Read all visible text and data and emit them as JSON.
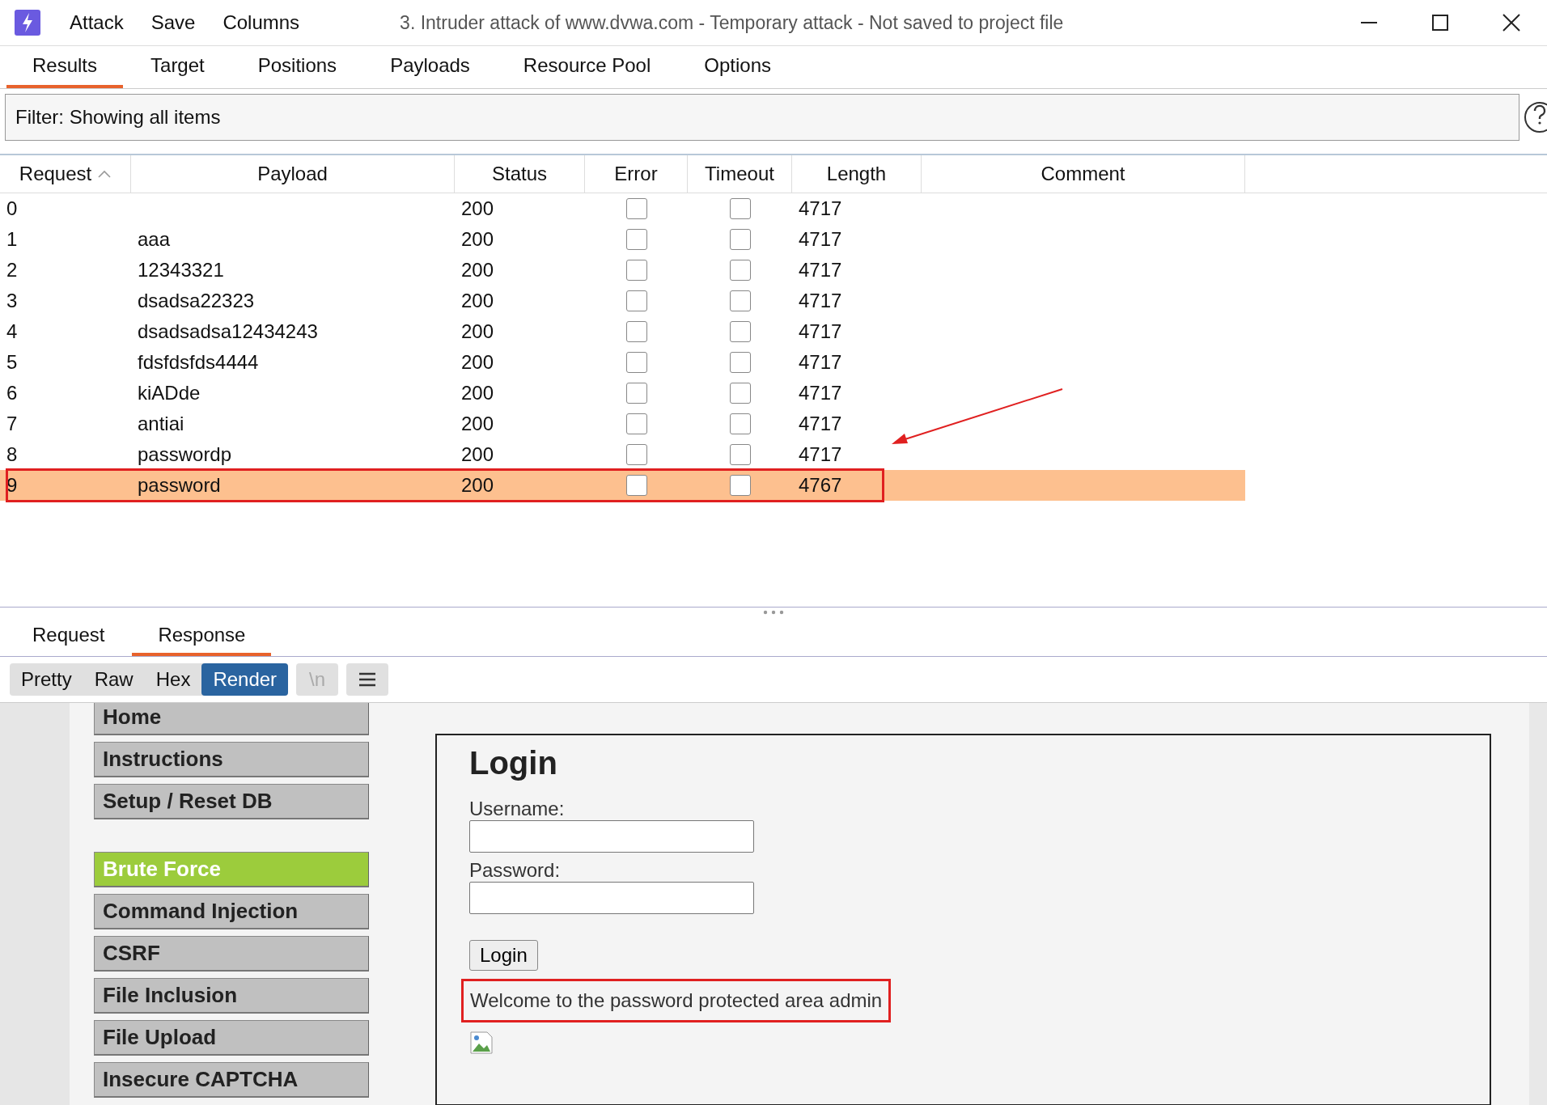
{
  "window": {
    "title": "3. Intruder attack of www.dvwa.com - Temporary attack - Not saved to project file",
    "menu": [
      "Attack",
      "Save",
      "Columns"
    ]
  },
  "tabs": [
    {
      "label": "Results",
      "selected": true
    },
    {
      "label": "Target",
      "selected": false
    },
    {
      "label": "Positions",
      "selected": false
    },
    {
      "label": "Payloads",
      "selected": false
    },
    {
      "label": "Resource Pool",
      "selected": false
    },
    {
      "label": "Options",
      "selected": false
    }
  ],
  "filter": {
    "text": "Filter: Showing all items"
  },
  "table": {
    "columns": [
      {
        "label": "Request",
        "sorted": true
      },
      {
        "label": "Payload",
        "sorted": false
      },
      {
        "label": "Status",
        "sorted": false
      },
      {
        "label": "Error",
        "sorted": false
      },
      {
        "label": "Timeout",
        "sorted": false
      },
      {
        "label": "Length",
        "sorted": false
      },
      {
        "label": "Comment",
        "sorted": false
      }
    ],
    "rows": [
      {
        "request": "0",
        "status": "200",
        "error": false,
        "timeout": false,
        "length": "4717",
        "selected": false,
        "highlighted": false
      },
      {
        "request": "1",
        "payload": "aaa",
        "status": "200",
        "error": false,
        "timeout": false,
        "length": "4717",
        "selected": false,
        "highlighted": false
      },
      {
        "request": "2",
        "payload": "12343321",
        "status": "200",
        "error": false,
        "timeout": false,
        "length": "4717",
        "selected": false,
        "highlighted": false
      },
      {
        "request": "3",
        "payload": "dsadsa22323",
        "status": "200",
        "error": false,
        "timeout": false,
        "length": "4717",
        "selected": false,
        "highlighted": false
      },
      {
        "request": "4",
        "payload": "dsadsadsa12434243",
        "status": "200",
        "error": false,
        "timeout": false,
        "length": "4717",
        "selected": false,
        "highlighted": false
      },
      {
        "request": "5",
        "payload": "fdsfdsfds4444",
        "status": "200",
        "error": false,
        "timeout": false,
        "length": "4717",
        "selected": false,
        "highlighted": false
      },
      {
        "request": "6",
        "payload": "kiADde",
        "status": "200",
        "error": false,
        "timeout": false,
        "length": "4717",
        "selected": false,
        "highlighted": false
      },
      {
        "request": "7",
        "payload": "antiai",
        "status": "200",
        "error": false,
        "timeout": false,
        "length": "4717",
        "selected": false,
        "highlighted": false
      },
      {
        "request": "8",
        "payload": "passwordp",
        "status": "200",
        "error": false,
        "timeout": false,
        "length": "4717",
        "selected": false,
        "highlighted": false
      },
      {
        "request": "9",
        "payload": "password",
        "status": "200",
        "error": false,
        "timeout": false,
        "length": "4767",
        "selected": true,
        "highlighted": true
      }
    ]
  },
  "message_tabs": [
    {
      "label": "Request",
      "selected": false
    },
    {
      "label": "Response",
      "selected": true
    }
  ],
  "view_modes": [
    {
      "label": "Pretty",
      "selected": false
    },
    {
      "label": "Raw",
      "selected": false
    },
    {
      "label": "Hex",
      "selected": false
    },
    {
      "label": "Render",
      "selected": true
    }
  ],
  "newline_button": {
    "label": "\\n",
    "disabled": true
  },
  "render": {
    "menu_groups": [
      [
        {
          "label": "Home",
          "selected": false
        },
        {
          "label": "Instructions",
          "selected": false
        },
        {
          "label": "Setup / Reset DB",
          "selected": false
        }
      ],
      [
        {
          "label": "Brute Force",
          "selected": true
        },
        {
          "label": "Command Injection",
          "selected": false
        },
        {
          "label": "CSRF",
          "selected": false
        },
        {
          "label": "File Inclusion",
          "selected": false
        },
        {
          "label": "File Upload",
          "selected": false
        },
        {
          "label": "Insecure CAPTCHA",
          "selected": false
        }
      ]
    ],
    "login": {
      "heading": "Login",
      "username_label": "Username:",
      "password_label": "Password:",
      "button": "Login",
      "message": "Welcome to the password protected area admin",
      "message_highlighted": true
    }
  }
}
